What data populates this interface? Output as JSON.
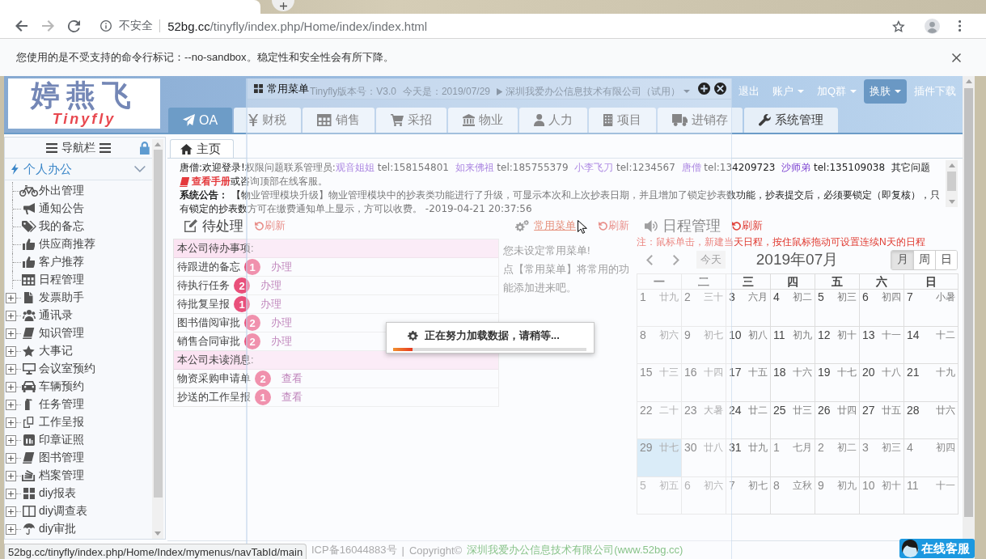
{
  "browser": {
    "security_label": "不安全",
    "url_host": "52bg.cc",
    "url_path": "/tinyfly/index.php/Home/index/index.html",
    "infobar": "您使用的是不受支持的命令行标记：--no-sandbox。稳定性和安全性会有所下降。"
  },
  "header": {
    "logo_title": "婷燕飞",
    "logo_subtitle": "Tinyfly",
    "version": "Tinyfly版本号：V3.0",
    "today": "今天是：2019/07/29",
    "company": "深圳我爱办公信息技术有限公司（试用）",
    "menu": [
      {
        "label": "退出",
        "kind": "link",
        "selected": false
      },
      {
        "label": "账户",
        "kind": "dropdown",
        "selected": false
      },
      {
        "label": "加Q群",
        "kind": "dropdown",
        "selected": false
      },
      {
        "label": "换肤",
        "kind": "dropdown",
        "selected": true
      },
      {
        "label": "插件下载",
        "kind": "link",
        "selected": false
      }
    ]
  },
  "module_tabs": [
    {
      "label": "OA",
      "selected": true
    },
    {
      "label": "财税",
      "selected": false
    },
    {
      "label": "销售",
      "selected": false
    },
    {
      "label": "采招",
      "selected": false
    },
    {
      "label": "物业",
      "selected": false
    },
    {
      "label": "人力",
      "selected": false
    },
    {
      "label": "项目",
      "selected": false
    },
    {
      "label": "进销存",
      "selected": false
    },
    {
      "label": "系统管理",
      "selected": false
    }
  ],
  "sidebar": {
    "title": "导航栏",
    "section": {
      "label": "个人办公",
      "expanded": true
    },
    "items": [
      {
        "label": "外出管理",
        "kind": "leaf"
      },
      {
        "label": "通知公告",
        "kind": "leaf"
      },
      {
        "label": "我的备忘",
        "kind": "leaf"
      },
      {
        "label": "供应商推荐",
        "kind": "leaf"
      },
      {
        "label": "客户推荐",
        "kind": "leaf"
      },
      {
        "label": "日程管理",
        "kind": "leaf"
      },
      {
        "label": "发票助手",
        "kind": "folder",
        "expanded": false
      },
      {
        "label": "通讯录",
        "kind": "folder",
        "expanded": false
      },
      {
        "label": "知识管理",
        "kind": "folder",
        "expanded": false
      },
      {
        "label": "大事记",
        "kind": "folder",
        "expanded": false
      },
      {
        "label": "会议室预约",
        "kind": "folder",
        "expanded": false
      },
      {
        "label": "车辆预约",
        "kind": "folder",
        "expanded": false
      },
      {
        "label": "任务管理",
        "kind": "folder",
        "expanded": false
      },
      {
        "label": "工作呈报",
        "kind": "folder",
        "expanded": false
      },
      {
        "label": "印章证照",
        "kind": "folder",
        "expanded": false
      },
      {
        "label": "图书管理",
        "kind": "folder",
        "expanded": false
      },
      {
        "label": "档案管理",
        "kind": "folder",
        "expanded": false
      },
      {
        "label": "diy报表",
        "kind": "folder",
        "expanded": false
      },
      {
        "label": "diy调查表",
        "kind": "folder",
        "expanded": false
      },
      {
        "label": "diy审批",
        "kind": "folder",
        "expanded": false
      }
    ]
  },
  "page_tab": {
    "label": "主页",
    "selected": true
  },
  "notices": {
    "welcome": [
      {
        "kind": "text",
        "text": "唐僧:欢迎登录!权限问题联系管理员:"
      },
      {
        "kind": "contact",
        "text": "观音姐姐"
      },
      {
        "kind": "text",
        "text": " tel:158154801  "
      },
      {
        "kind": "contact",
        "text": "如来佛祖"
      },
      {
        "kind": "text",
        "text": " tel:185755379  "
      },
      {
        "kind": "contact",
        "text": "小李飞刀"
      },
      {
        "kind": "text",
        "text": " tel:1234567  "
      },
      {
        "kind": "contact",
        "text": "唐僧"
      },
      {
        "kind": "text",
        "text": " tel:134209723  "
      },
      {
        "kind": "contact",
        "text": "沙师弟"
      },
      {
        "kind": "text",
        "text": " tel:135109038  其它问题"
      },
      {
        "kind": "link",
        "text": "查看手册"
      },
      {
        "kind": "text",
        "text": "或咨询顶部在线客服。"
      }
    ],
    "announcement": "**系统公告：** 【物业管理模块升级】物业管理模块中的抄表类功能进行了升级，可显示本次和上次抄表日期，并且增加了锁定抄表数功能，抄表提交后，必须要锁定（即复核），只有锁定的抄表数方可在缴费通知单上显示，方可以收费。 -2019-04-21 20:37:56"
  },
  "todo": {
    "title": "待处理",
    "refresh": "刷新",
    "sections": [
      {
        "heading": "本公司待办事项:",
        "rows": [
          {
            "label": "待跟进的备忘",
            "count": "1",
            "action": "办理"
          },
          {
            "label": "待执行任务",
            "count": "2",
            "action": "办理"
          },
          {
            "label": "待批复呈报",
            "count": "1",
            "action": "办理"
          },
          {
            "label": "图书借阅审批",
            "count": "2",
            "action": "办理"
          },
          {
            "label": "销售合同审批",
            "count": "2",
            "action": "办理"
          }
        ]
      },
      {
        "heading": "本公司未读消息:",
        "rows": [
          {
            "label": "物资采购申请单",
            "count": "2",
            "action": "查看"
          },
          {
            "label": "抄送的工作呈报",
            "count": "1",
            "action": "查看"
          }
        ]
      }
    ]
  },
  "favorites": {
    "title": "常用菜单",
    "refresh": "刷新",
    "lines": [
      "您未设定常用菜单!",
      "点【常用菜单】将常用的功能添加进来吧。"
    ]
  },
  "schedule": {
    "title": "日程管理",
    "refresh": "刷新",
    "note": "注：鼠标单击，新建当天日程，按住鼠标拖动可设置连续N天的日程",
    "today_button": "今天",
    "month_title": "2019年07月",
    "views": [
      {
        "label": "月",
        "selected": true
      },
      {
        "label": "周",
        "selected": false
      },
      {
        "label": "日",
        "selected": false
      }
    ],
    "weekdays": [
      "一",
      "二",
      "三",
      "四",
      "五",
      "六",
      "日"
    ],
    "weeks": [
      [
        {
          "day": "1",
          "lunar": "廿九",
          "other_month": false,
          "today": false
        },
        {
          "day": "2",
          "lunar": "三十",
          "other_month": false,
          "today": false
        },
        {
          "day": "3",
          "lunar": "六月",
          "other_month": false,
          "today": false
        },
        {
          "day": "4",
          "lunar": "初二",
          "other_month": false,
          "today": false
        },
        {
          "day": "5",
          "lunar": "初三",
          "other_month": false,
          "today": false
        },
        {
          "day": "6",
          "lunar": "初四",
          "other_month": false,
          "today": false
        },
        {
          "day": "7",
          "lunar": "小暑",
          "other_month": false,
          "today": false
        }
      ],
      [
        {
          "day": "8",
          "lunar": "初六",
          "other_month": false,
          "today": false
        },
        {
          "day": "9",
          "lunar": "初七",
          "other_month": false,
          "today": false
        },
        {
          "day": "10",
          "lunar": "初八",
          "other_month": false,
          "today": false
        },
        {
          "day": "11",
          "lunar": "初九",
          "other_month": false,
          "today": false
        },
        {
          "day": "12",
          "lunar": "初十",
          "other_month": false,
          "today": false
        },
        {
          "day": "13",
          "lunar": "十一",
          "other_month": false,
          "today": false
        },
        {
          "day": "14",
          "lunar": "十二",
          "other_month": false,
          "today": false
        }
      ],
      [
        {
          "day": "15",
          "lunar": "十三",
          "other_month": false,
          "today": false
        },
        {
          "day": "16",
          "lunar": "十四",
          "other_month": false,
          "today": false
        },
        {
          "day": "17",
          "lunar": "十五",
          "other_month": false,
          "today": false
        },
        {
          "day": "18",
          "lunar": "十六",
          "other_month": false,
          "today": false
        },
        {
          "day": "19",
          "lunar": "十七",
          "other_month": false,
          "today": false
        },
        {
          "day": "20",
          "lunar": "十八",
          "other_month": false,
          "today": false
        },
        {
          "day": "21",
          "lunar": "十九",
          "other_month": false,
          "today": false
        }
      ],
      [
        {
          "day": "22",
          "lunar": "二十",
          "other_month": false,
          "today": false
        },
        {
          "day": "23",
          "lunar": "大暑",
          "other_month": false,
          "today": false
        },
        {
          "day": "24",
          "lunar": "廿二",
          "other_month": false,
          "today": false
        },
        {
          "day": "25",
          "lunar": "廿三",
          "other_month": false,
          "today": false
        },
        {
          "day": "26",
          "lunar": "廿四",
          "other_month": false,
          "today": false
        },
        {
          "day": "27",
          "lunar": "廿五",
          "other_month": false,
          "today": false
        },
        {
          "day": "28",
          "lunar": "廿六",
          "other_month": false,
          "today": false
        }
      ],
      [
        {
          "day": "29",
          "lunar": "廿七",
          "other_month": false,
          "today": true
        },
        {
          "day": "30",
          "lunar": "廿八",
          "other_month": false,
          "today": false
        },
        {
          "day": "31",
          "lunar": "廿九",
          "other_month": false,
          "today": false
        },
        {
          "day": "1",
          "lunar": "七月",
          "other_month": true,
          "today": false
        },
        {
          "day": "2",
          "lunar": "初二",
          "other_month": true,
          "today": false
        },
        {
          "day": "3",
          "lunar": "初三",
          "other_month": true,
          "today": false
        },
        {
          "day": "4",
          "lunar": "初四",
          "other_month": true,
          "today": false
        }
      ],
      [
        {
          "day": "5",
          "lunar": "初五",
          "other_month": true,
          "today": false
        },
        {
          "day": "6",
          "lunar": "初六",
          "other_month": true,
          "today": false
        },
        {
          "day": "7",
          "lunar": "初七",
          "other_month": true,
          "today": false
        },
        {
          "day": "8",
          "lunar": "立秋",
          "other_month": true,
          "today": false
        },
        {
          "day": "9",
          "lunar": "初九",
          "other_month": true,
          "today": false
        },
        {
          "day": "10",
          "lunar": "初十",
          "other_month": true,
          "today": false
        },
        {
          "day": "11",
          "lunar": "十一",
          "other_month": true,
          "today": false
        }
      ]
    ]
  },
  "footer": {
    "icp": "ICP备16044883号",
    "separator": "|",
    "copyright": "Copyright©",
    "company": "深圳我爱办公信息技术有限公司(www.52bg.cc)"
  },
  "status_url": "52bg.cc/tinyfly/index.php/Home/Index/mymenus/navTabId/main",
  "support_button": "在线客服",
  "modal": {
    "title": "常用菜单"
  },
  "loading": {
    "message": "正在努力加载数据，请稍等...",
    "level": 0.1
  }
}
